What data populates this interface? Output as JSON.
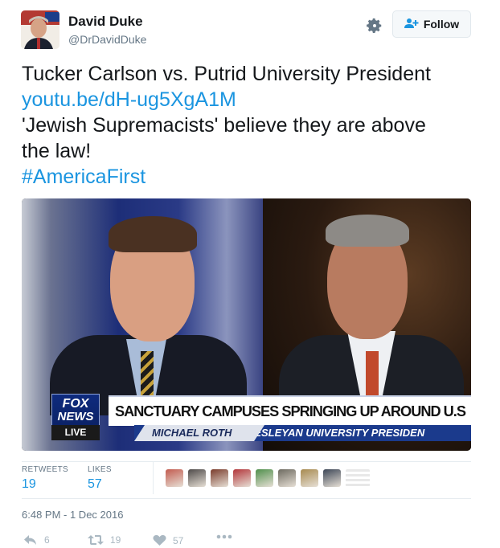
{
  "user": {
    "display_name": "David Duke",
    "handle": "@DrDavidDuke",
    "avatar_icon": "profile-photo"
  },
  "header": {
    "settings_icon": "gear-icon",
    "follow_label": "Follow",
    "follow_icon": "add-person-icon"
  },
  "tweet": {
    "line1": "Tucker Carlson vs. Putrid University President",
    "link": "youtu.be/dH-ug5XgA1M",
    "line3": "'Jewish Supremacists' believe they are above",
    "line4": "the law!",
    "hashtag": "#AmericaFirst"
  },
  "media": {
    "logo_line1": "FOX",
    "logo_line2": "NEWS",
    "live_label": "LIVE",
    "headline": "SANCTUARY CAMPUSES SPRINGING UP AROUND U.S",
    "guest_name": "MICHAEL ROTH",
    "guest_title": "WESLEYAN UNIVERSITY PRESIDEN"
  },
  "stats": {
    "retweets_label": "RETWEETS",
    "retweets_value": "19",
    "likes_label": "LIKES",
    "likes_value": "57",
    "liker_colors": [
      "#c25b4f",
      "#4e4a49",
      "#7a3b2b",
      "#b2353a",
      "#4f8f4b",
      "#6d6a60",
      "#a78a4f",
      "#3c4656"
    ]
  },
  "timestamp": "6:48 PM - 1 Dec 2016",
  "actions": {
    "reply_count": "6",
    "retweet_count": "19",
    "like_count": "57",
    "reply_icon": "reply-icon",
    "retweet_icon": "retweet-icon",
    "like_icon": "heart-icon",
    "more_icon": "more-icon"
  }
}
